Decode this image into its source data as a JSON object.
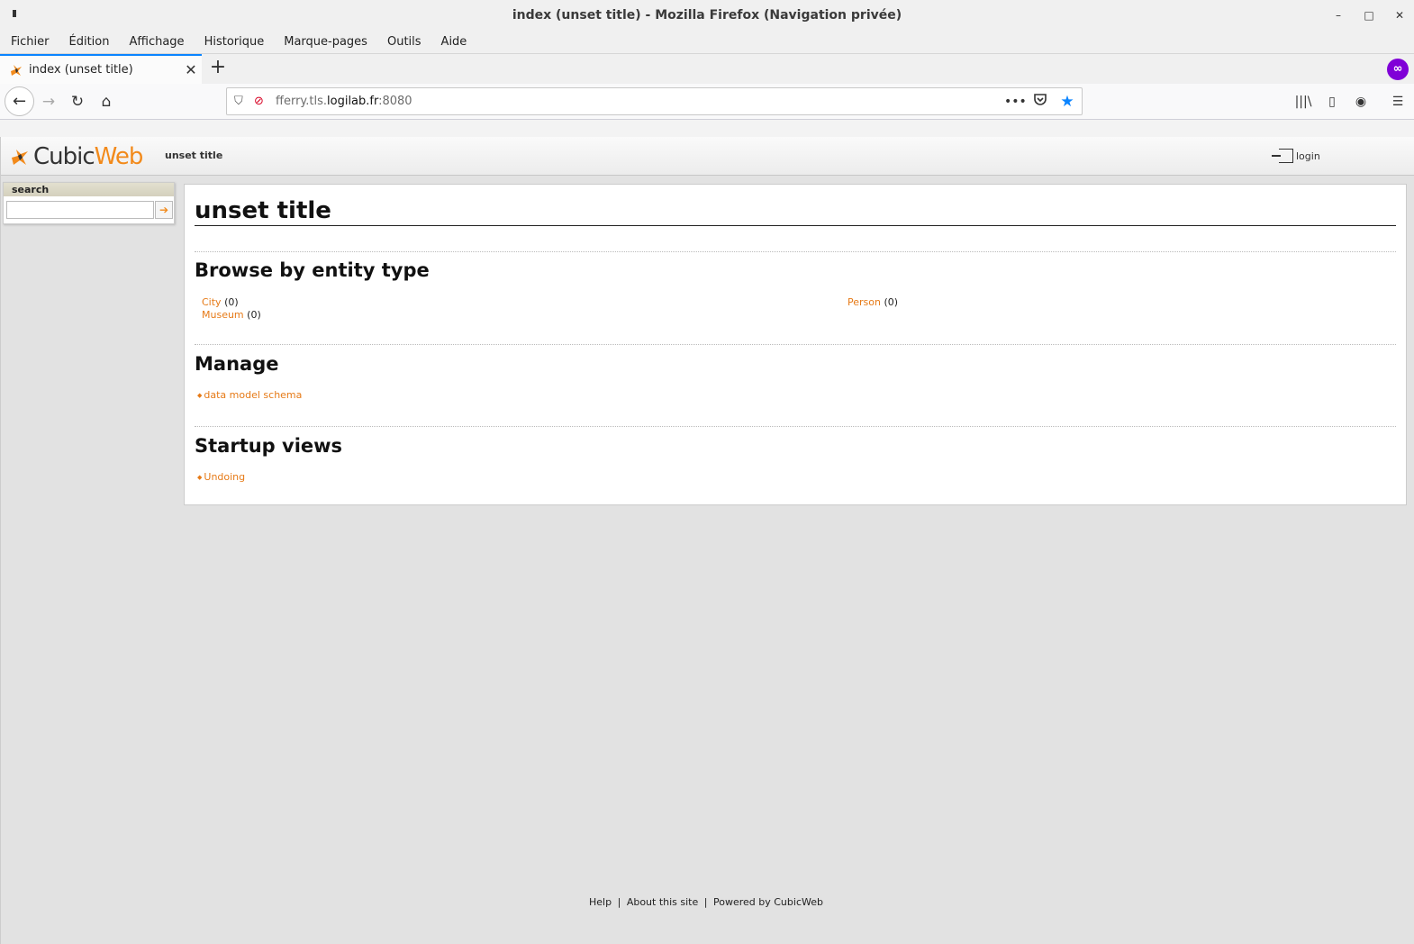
{
  "window": {
    "title": "index (unset title) - Mozilla Firefox (Navigation privée)",
    "minimize": "–",
    "maximize": "□",
    "close": "✕"
  },
  "menubar": {
    "items": [
      "Fichier",
      "Édition",
      "Affichage",
      "Historique",
      "Marque-pages",
      "Outils",
      "Aide"
    ]
  },
  "tab": {
    "title": "index (unset title)",
    "close": "✕",
    "new_tab": "+"
  },
  "nav": {
    "back": "←",
    "forward": "→",
    "reload": "↻",
    "home": "⌂",
    "url_prefix": "fferry.tls.",
    "url_domain": "logilab.fr",
    "url_suffix": ":8080",
    "page_actions": "•••",
    "pocket": "◡",
    "bookmark": "★",
    "library": "|||\\",
    "sidebar": "▯",
    "account": "◉",
    "menu": "☰"
  },
  "page": {
    "logo_part1": "Cubic",
    "logo_part2": "Web",
    "header_title": "unset title",
    "login": "login",
    "search_title": "search",
    "search_go": "➔",
    "h1": "unset title",
    "browse_heading": "Browse by entity type",
    "entity_types": [
      {
        "name": "City",
        "count": "(0)"
      },
      {
        "name": "Person",
        "count": "(0)"
      },
      {
        "name": "Museum",
        "count": "(0)"
      }
    ],
    "manage_heading": "Manage",
    "manage_links": [
      "data model schema"
    ],
    "startup_heading": "Startup views",
    "startup_links": [
      "Undoing"
    ],
    "footer": {
      "help": "Help",
      "sep": "|",
      "about": "About this site",
      "powered": "Powered by CubicWeb"
    }
  },
  "colors": {
    "accent": "#e67a17",
    "firefox_blue": "#0a84ff",
    "private_purple": "#8000d7"
  }
}
